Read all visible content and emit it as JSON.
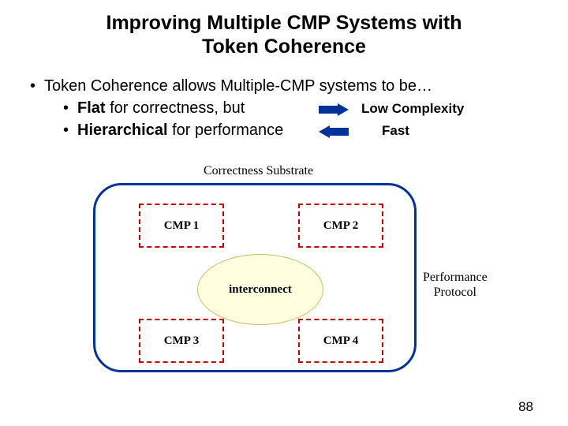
{
  "title": {
    "line1": "Improving Multiple CMP Systems with",
    "line2": "Token Coherence"
  },
  "bullets": {
    "main": "Token Coherence allows Multiple-CMP systems to be…",
    "sub1_prefix": "Flat",
    "sub1_rest": " for correctness, but",
    "sub2_prefix": "Hierarchical",
    "sub2_rest": " for performance"
  },
  "annotations": {
    "low_complexity": "Low Complexity",
    "fast": "Fast"
  },
  "diagram": {
    "correctness_label": "Correctness Substrate",
    "interconnect": "interconnect",
    "perf_protocol_l1": "Performance",
    "perf_protocol_l2": "Protocol",
    "cmp1": "CMP 1",
    "cmp2": "CMP 2",
    "cmp3": "CMP 3",
    "cmp4": "CMP 4"
  },
  "page_number": "88"
}
